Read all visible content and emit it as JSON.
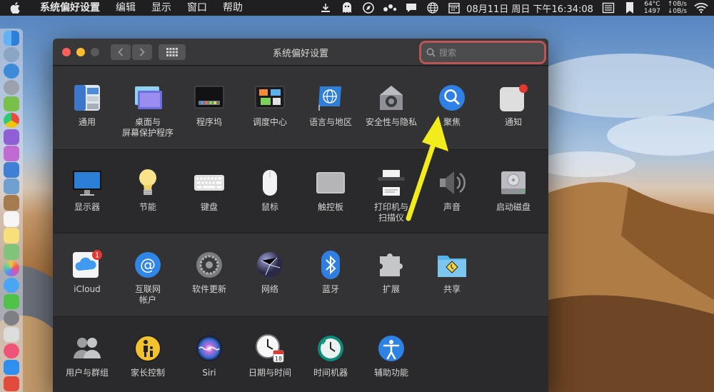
{
  "menubar": {
    "app_name": "系统偏好设置",
    "items": [
      "编辑",
      "显示",
      "窗口",
      "帮助"
    ],
    "clock": "08月11日 周日 下午16:34:08",
    "temp": "64°C",
    "fan": "1497",
    "net_up": "↑0B/s",
    "net_down": "↓0B/s"
  },
  "window": {
    "title": "系统偏好设置",
    "search_placeholder": "搜索",
    "sections": [
      {
        "items": [
          {
            "label": "通用",
            "icon": "general-icon"
          },
          {
            "label": "桌面与\n屏幕保护程序",
            "icon": "desktop-screensaver-icon"
          },
          {
            "label": "程序坞",
            "icon": "dock-icon"
          },
          {
            "label": "调度中心",
            "icon": "mission-control-icon"
          },
          {
            "label": "语言与地区",
            "icon": "language-region-icon"
          },
          {
            "label": "安全性与隐私",
            "icon": "security-privacy-icon"
          },
          {
            "label": "聚焦",
            "icon": "spotlight-icon"
          },
          {
            "label": "通知",
            "icon": "notifications-icon"
          }
        ]
      },
      {
        "items": [
          {
            "label": "显示器",
            "icon": "displays-icon"
          },
          {
            "label": "节能",
            "icon": "energy-saver-icon"
          },
          {
            "label": "键盘",
            "icon": "keyboard-icon"
          },
          {
            "label": "鼠标",
            "icon": "mouse-icon"
          },
          {
            "label": "触控板",
            "icon": "trackpad-icon"
          },
          {
            "label": "打印机与\n扫描仪",
            "icon": "printers-scanners-icon"
          },
          {
            "label": "声音",
            "icon": "sound-icon"
          },
          {
            "label": "启动磁盘",
            "icon": "startup-disk-icon"
          }
        ]
      },
      {
        "items": [
          {
            "label": "iCloud",
            "icon": "icloud-icon",
            "badge": "1"
          },
          {
            "label": "互联网\n帐户",
            "icon": "internet-accounts-icon"
          },
          {
            "label": "软件更新",
            "icon": "software-update-icon"
          },
          {
            "label": "网络",
            "icon": "network-icon"
          },
          {
            "label": "蓝牙",
            "icon": "bluetooth-icon"
          },
          {
            "label": "扩展",
            "icon": "extensions-icon"
          },
          {
            "label": "共享",
            "icon": "sharing-icon"
          }
        ]
      },
      {
        "items": [
          {
            "label": "用户与群组",
            "icon": "users-groups-icon"
          },
          {
            "label": "家长控制",
            "icon": "parental-controls-icon"
          },
          {
            "label": "Siri",
            "icon": "siri-icon"
          },
          {
            "label": "日期与时间",
            "icon": "date-time-icon"
          },
          {
            "label": "时间机器",
            "icon": "time-machine-icon"
          },
          {
            "label": "辅助功能",
            "icon": "accessibility-icon"
          }
        ]
      }
    ]
  },
  "colors": {
    "window_bg": "#2a2a2c",
    "search_focus": "#eb5f5f",
    "annotation_arrow": "#f2ec1c"
  }
}
